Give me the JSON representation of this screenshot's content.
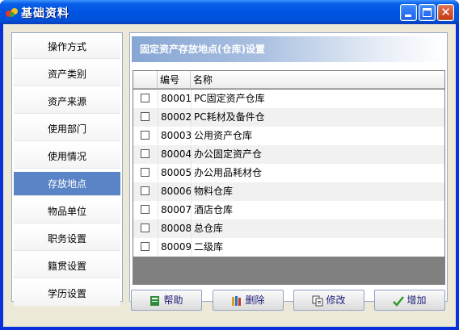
{
  "window": {
    "title": "基础资料"
  },
  "sidebar": {
    "items": [
      {
        "label": "操作方式",
        "active": false
      },
      {
        "label": "资产类别",
        "active": false
      },
      {
        "label": "资产来源",
        "active": false
      },
      {
        "label": "使用部门",
        "active": false
      },
      {
        "label": "使用情况",
        "active": false
      },
      {
        "label": "存放地点",
        "active": true
      },
      {
        "label": "物品单位",
        "active": false
      },
      {
        "label": "职务设置",
        "active": false
      },
      {
        "label": "籍贯设置",
        "active": false
      },
      {
        "label": "学历设置",
        "active": false
      }
    ]
  },
  "panel": {
    "title": "固定资产存放地点(仓库)设置"
  },
  "table": {
    "columns": [
      "编号",
      "名称"
    ],
    "rows": [
      {
        "code": "80001",
        "name": "PC固定资产仓库"
      },
      {
        "code": "80002",
        "name": "PC耗材及备件仓"
      },
      {
        "code": "80003",
        "name": "公用资产仓库"
      },
      {
        "code": "80004",
        "name": "办公固定资产仓"
      },
      {
        "code": "80005",
        "name": "办公用品耗材仓"
      },
      {
        "code": "80006",
        "name": "物料仓库"
      },
      {
        "code": "80007",
        "name": "酒店仓库"
      },
      {
        "code": "80008",
        "name": "总仓库"
      },
      {
        "code": "80009",
        "name": "二级库"
      }
    ]
  },
  "buttons": {
    "help": "帮助",
    "delete": "删除",
    "edit": "修改",
    "add": "增加"
  },
  "colors": {
    "title_bar": "#0054e3",
    "active_nav": "#5b84c6",
    "client_bg": "#ece9d8"
  }
}
